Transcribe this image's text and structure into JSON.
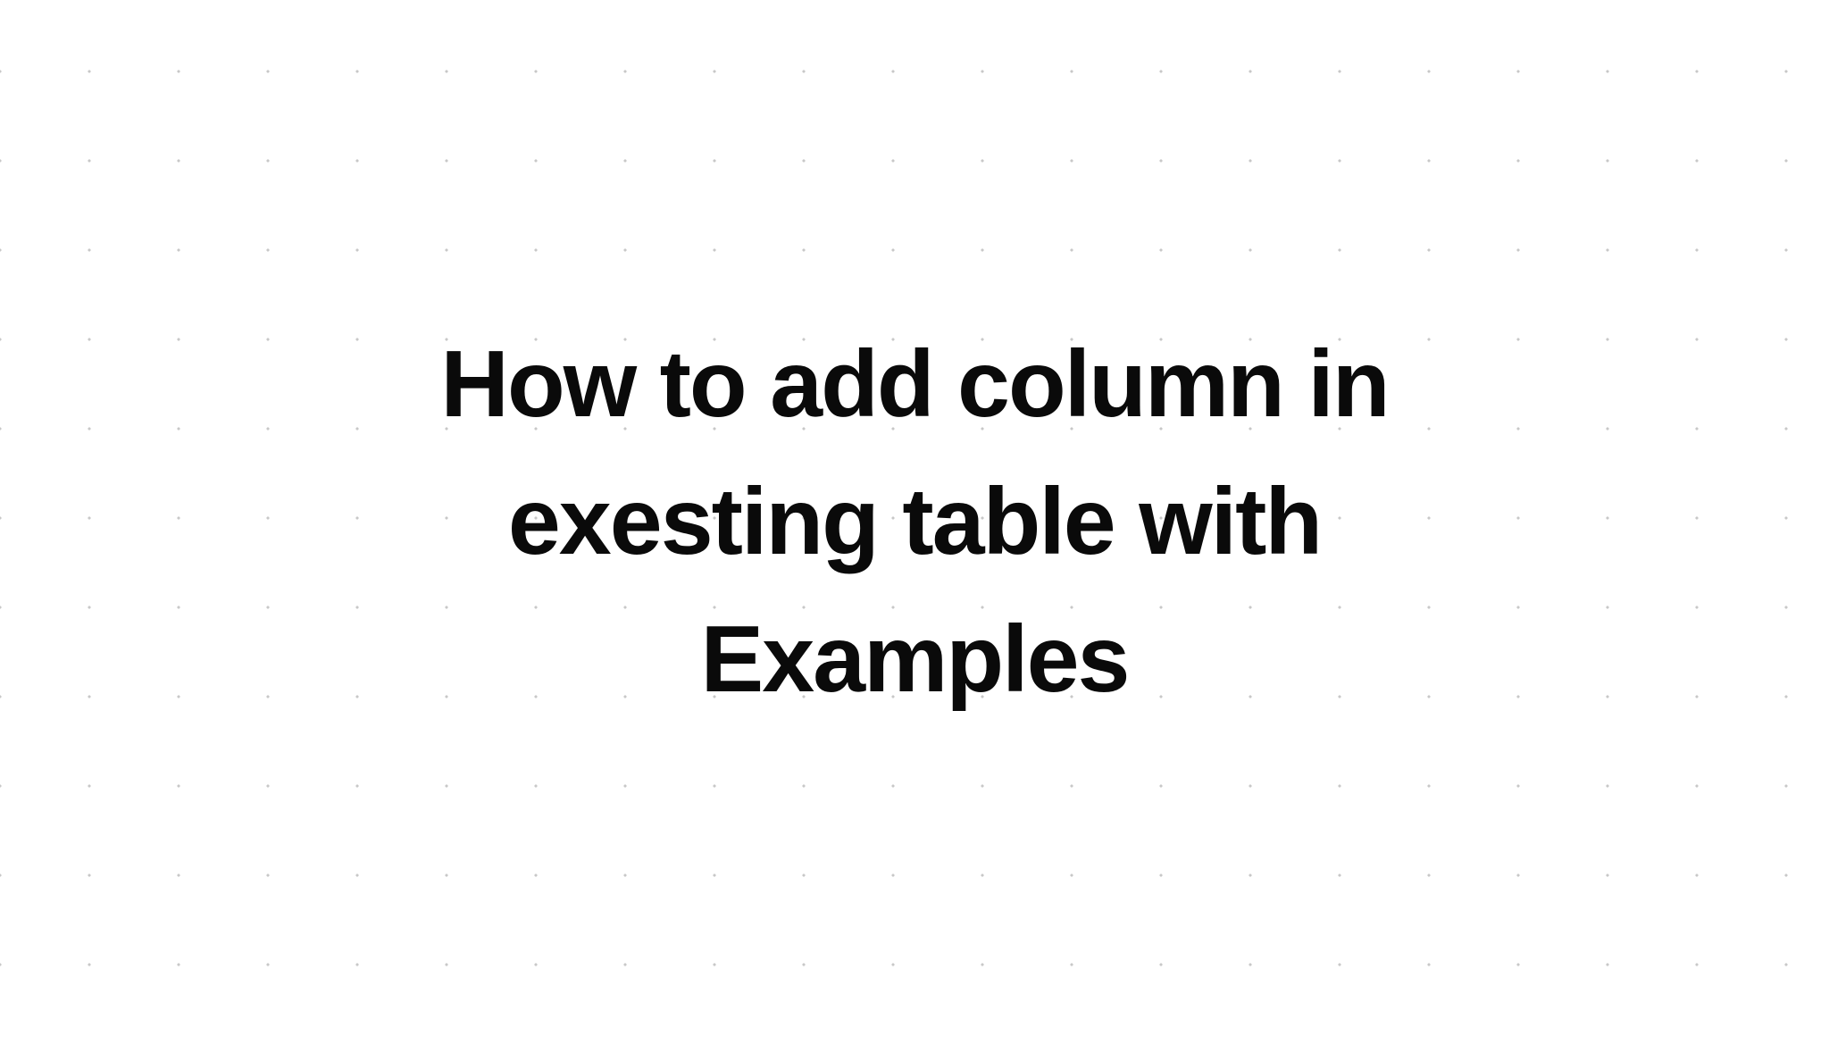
{
  "title": "How to add column in exesting table with Examples"
}
